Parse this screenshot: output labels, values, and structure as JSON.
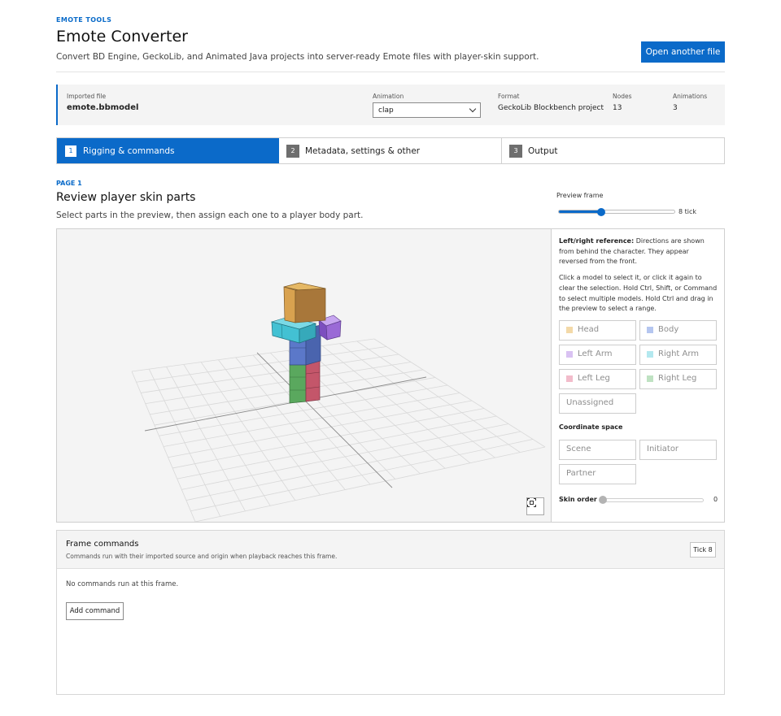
{
  "header": {
    "eyebrow": "EMOTE TOOLS",
    "title": "Emote Converter",
    "subtitle": "Convert BD Engine, GeckoLib, and Animated Java projects into server-ready Emote files with player-skin support.",
    "open_button": "Open another file"
  },
  "file_info": {
    "imported_label": "Imported file",
    "imported_value": "emote.bbmodel",
    "animation_label": "Animation",
    "animation_value": "clap",
    "format_label": "Format",
    "format_value": "GeckoLib Blockbench project",
    "nodes_label": "Nodes",
    "nodes_value": "13",
    "animations_label": "Animations",
    "animations_value": "3"
  },
  "steps": [
    {
      "num": "1",
      "label": "Rigging & commands",
      "active": true
    },
    {
      "num": "2",
      "label": "Metadata, settings & other",
      "active": false
    },
    {
      "num": "3",
      "label": "Output",
      "active": false
    }
  ],
  "page": {
    "eyebrow": "PAGE 1",
    "title": "Review player skin parts",
    "subtitle": "Select parts in the preview, then assign each one to a player body part."
  },
  "preview_frame": {
    "label": "Preview frame",
    "value_text": "8 tick",
    "fraction": 0.37
  },
  "panel": {
    "ref_bold": "Left/right reference:",
    "ref_text": " Directions are shown from behind the character. They appear reversed from the front.",
    "help_text": "Click a model to select it, or click it again to clear the selection. Hold Ctrl, Shift, or Command to select multiple models. Hold Ctrl and drag in the preview to select a range.",
    "parts": [
      {
        "label": "Head",
        "color": "#f3d9a8"
      },
      {
        "label": "Body",
        "color": "#b5c6f0"
      },
      {
        "label": "Left Arm",
        "color": "#d9c2f2"
      },
      {
        "label": "Right Arm",
        "color": "#b3e8ef"
      },
      {
        "label": "Left Leg",
        "color": "#f2bccb"
      },
      {
        "label": "Right Leg",
        "color": "#bfe2c2"
      },
      {
        "label": "Unassigned",
        "color": ""
      }
    ],
    "coord_title": "Coordinate space",
    "coords": [
      "Scene",
      "Initiator",
      "Partner"
    ],
    "skin_label": "Skin order",
    "skin_value": "0"
  },
  "frame_commands": {
    "title": "Frame commands",
    "subtitle": "Commands run with their imported source and origin when playback reaches this frame.",
    "tick_badge": "Tick 8",
    "empty_text": "No commands run at this frame.",
    "add_button": "Add command"
  },
  "icons": {
    "recenter": "recenter-icon",
    "select_chevron": "chevron-down-icon"
  },
  "colors": {
    "accent": "#0b6ac9",
    "head": "#d9a24f",
    "body": "#5b78c9",
    "arm_left": "#9a6ad6",
    "arm_right": "#43c1d3",
    "leg_left": "#c4566a",
    "leg_right": "#5aa85e"
  }
}
